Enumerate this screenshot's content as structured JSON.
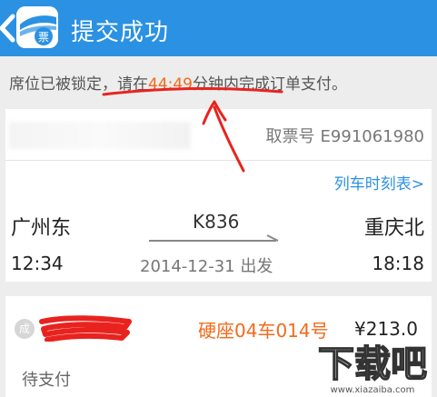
{
  "header": {
    "title": "提交成功",
    "logo_text": "票"
  },
  "notice": {
    "prefix": "席位已被锁定，请在",
    "timer": "44:49",
    "suffix": "分钟内完成订单支付。"
  },
  "ticket": {
    "number_label": "取票号",
    "number": "E991061980",
    "timetable_link": "列车时刻表>",
    "from_station": "广州东",
    "to_station": "重庆北",
    "train_no": "K836",
    "depart_time": "12:34",
    "arrive_time": "18:18",
    "date_text": "2014-12-31 出发"
  },
  "passenger": {
    "badge": "成",
    "seat": "硬座04车014号",
    "price": "¥213.0",
    "status": "待支付"
  },
  "watermark": {
    "text": "下载吧",
    "url": "www.xiazaiba.com"
  },
  "colors": {
    "header": "#2b91e3",
    "accent_orange": "#f26a1b",
    "annotation_red": "#e8231f"
  }
}
